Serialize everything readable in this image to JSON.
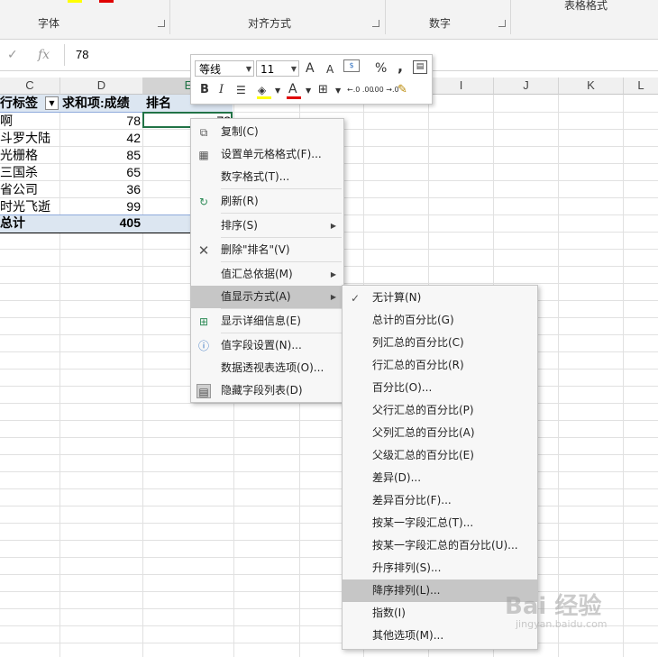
{
  "ribbon": {
    "groups": [
      {
        "label": "字体"
      },
      {
        "label": "对齐方式"
      },
      {
        "label": "数字"
      }
    ],
    "top_partial": "表格格式"
  },
  "formula_bar": {
    "cancel_icon": "✓",
    "fx_label": "fx",
    "value": "78"
  },
  "columns": [
    "C",
    "D",
    "E",
    "I",
    "J",
    "K",
    "L"
  ],
  "pivot": {
    "headers": [
      "行标签",
      "求和项:成绩",
      "排名"
    ],
    "rows": [
      {
        "label": "啊",
        "value": "78",
        "e": "78"
      },
      {
        "label": "斗罗大陆",
        "value": "42"
      },
      {
        "label": "光栅格",
        "value": "85"
      },
      {
        "label": "三国杀",
        "value": "65"
      },
      {
        "label": "省公司",
        "value": "36"
      },
      {
        "label": "时光飞逝",
        "value": "99"
      }
    ],
    "total_label": "总计",
    "total_value": "405"
  },
  "mini_toolbar": {
    "font": "等线",
    "size": "11",
    "grow": "A",
    "shrink": "A",
    "percent": "%",
    "comma": ",",
    "bold": "B",
    "italic": "I",
    "font_color": "A",
    "dec_inc": "←.0 .00",
    "dec_dec": ".00 →.0"
  },
  "context_menu": {
    "items": [
      {
        "label": "复制(C)",
        "icon": "copy-icon"
      },
      {
        "label": "设置单元格格式(F)...",
        "icon": "format-cells-icon"
      },
      {
        "label": "数字格式(T)...",
        "icon": ""
      },
      {
        "label": "刷新(R)",
        "icon": "refresh-icon"
      },
      {
        "label": "排序(S)",
        "icon": "",
        "submenu": true
      },
      {
        "label": "删除\"排名\"(V)",
        "icon": "delete-icon"
      },
      {
        "label": "值汇总依据(M)",
        "icon": "",
        "submenu": true
      },
      {
        "label": "值显示方式(A)",
        "icon": "",
        "submenu": true
      },
      {
        "label": "显示详细信息(E)",
        "icon": "show-detail-icon"
      },
      {
        "label": "值字段设置(N)...",
        "icon": "field-settings-icon"
      },
      {
        "label": "数据透视表选项(O)...",
        "icon": ""
      },
      {
        "label": "隐藏字段列表(D)",
        "icon": "field-list-icon"
      }
    ]
  },
  "submenu": {
    "checked_mark": "✓",
    "items": [
      {
        "label": "无计算(N)"
      },
      {
        "label": "总计的百分比(G)"
      },
      {
        "label": "列汇总的百分比(C)"
      },
      {
        "label": "行汇总的百分比(R)"
      },
      {
        "label": "百分比(O)..."
      },
      {
        "label": "父行汇总的百分比(P)"
      },
      {
        "label": "父列汇总的百分比(A)"
      },
      {
        "label": "父级汇总的百分比(E)"
      },
      {
        "label": "差异(D)..."
      },
      {
        "label": "差异百分比(F)..."
      },
      {
        "label": "按某一字段汇总(T)..."
      },
      {
        "label": "按某一字段汇总的百分比(U)..."
      },
      {
        "label": "升序排列(S)..."
      },
      {
        "label": "降序排列(L)..."
      },
      {
        "label": "指数(I)"
      },
      {
        "label": "其他选项(M)..."
      }
    ]
  },
  "watermark": {
    "brand": "Bai 经验",
    "url": "jingyan.baidu.com"
  },
  "colors": {
    "header_blue": "#dce6f1",
    "highlight": "#c6c6c6",
    "selected_border": "#217346"
  }
}
